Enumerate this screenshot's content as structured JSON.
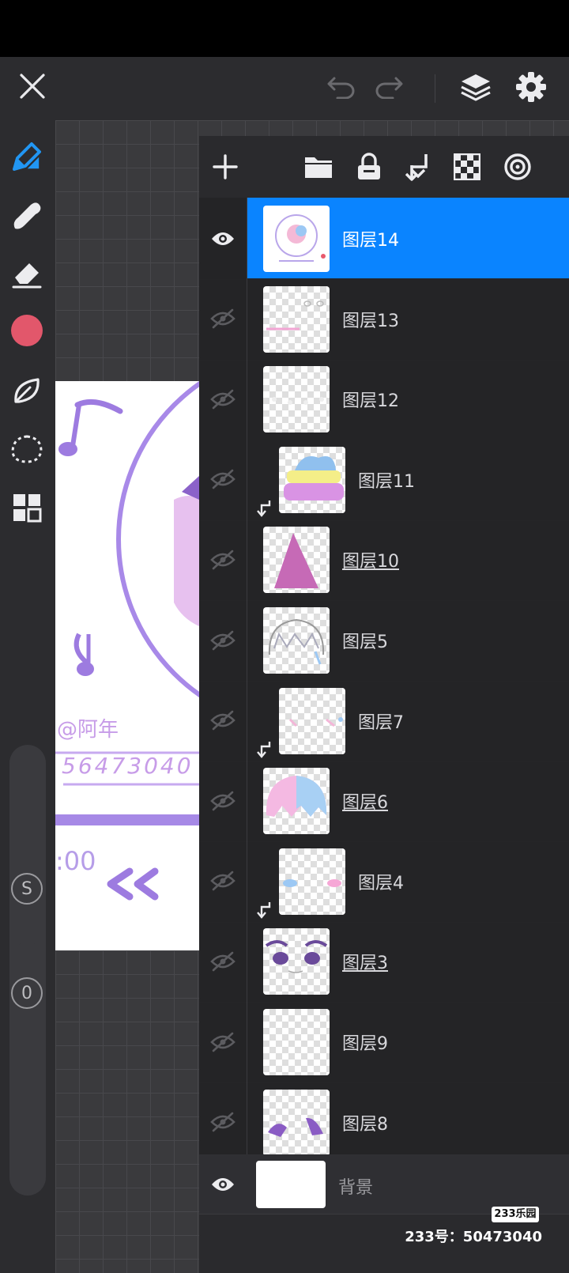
{
  "app": {
    "name": "Painting app layers panel"
  },
  "top_bar": {
    "icons": [
      "close-icon",
      "undo-icon",
      "redo-icon",
      "layers-icon",
      "settings-gear-icon"
    ]
  },
  "toolbar": {
    "tools": [
      "brush-icon",
      "smudge-icon",
      "eraser-icon",
      "color-swatch",
      "leaf-icon",
      "lasso-selection-icon",
      "grid-icon"
    ],
    "color": "#e2576b",
    "size_label": "S",
    "opacity_label": "0"
  },
  "layers_panel": {
    "tools": [
      "add-layer-icon",
      "folder-icon",
      "lock-icon",
      "merge-down-icon",
      "checkerboard-icon",
      "blend-mode-icon"
    ],
    "accent": "#0a84ff",
    "layers": [
      {
        "name": "图层14",
        "visible": true,
        "selected": true,
        "clipped": false,
        "underlined": false
      },
      {
        "name": "图层13",
        "visible": false,
        "selected": false,
        "clipped": false,
        "underlined": false
      },
      {
        "name": "图层12",
        "visible": false,
        "selected": false,
        "clipped": false,
        "underlined": false
      },
      {
        "name": "图层11",
        "visible": false,
        "selected": false,
        "clipped": true,
        "underlined": false
      },
      {
        "name": "图层10",
        "visible": false,
        "selected": false,
        "clipped": false,
        "underlined": true
      },
      {
        "name": "图层5",
        "visible": false,
        "selected": false,
        "clipped": false,
        "underlined": false
      },
      {
        "name": "图层7",
        "visible": false,
        "selected": false,
        "clipped": true,
        "underlined": false
      },
      {
        "name": "图层6",
        "visible": false,
        "selected": false,
        "clipped": false,
        "underlined": true
      },
      {
        "name": "图层4",
        "visible": false,
        "selected": false,
        "clipped": true,
        "underlined": false
      },
      {
        "name": "图层3",
        "visible": false,
        "selected": false,
        "clipped": false,
        "underlined": true
      },
      {
        "name": "图层9",
        "visible": false,
        "selected": false,
        "clipped": false,
        "underlined": false
      },
      {
        "name": "图层8",
        "visible": false,
        "selected": false,
        "clipped": false,
        "underlined": false
      }
    ],
    "background_layer": {
      "name": "背景",
      "visible": true
    }
  },
  "canvas": {
    "art_text_1": "@阿年",
    "art_text_2": "56473040",
    "art_time": ":00"
  },
  "watermark": {
    "logo": "233乐园",
    "id_text": "233号：50473040"
  }
}
